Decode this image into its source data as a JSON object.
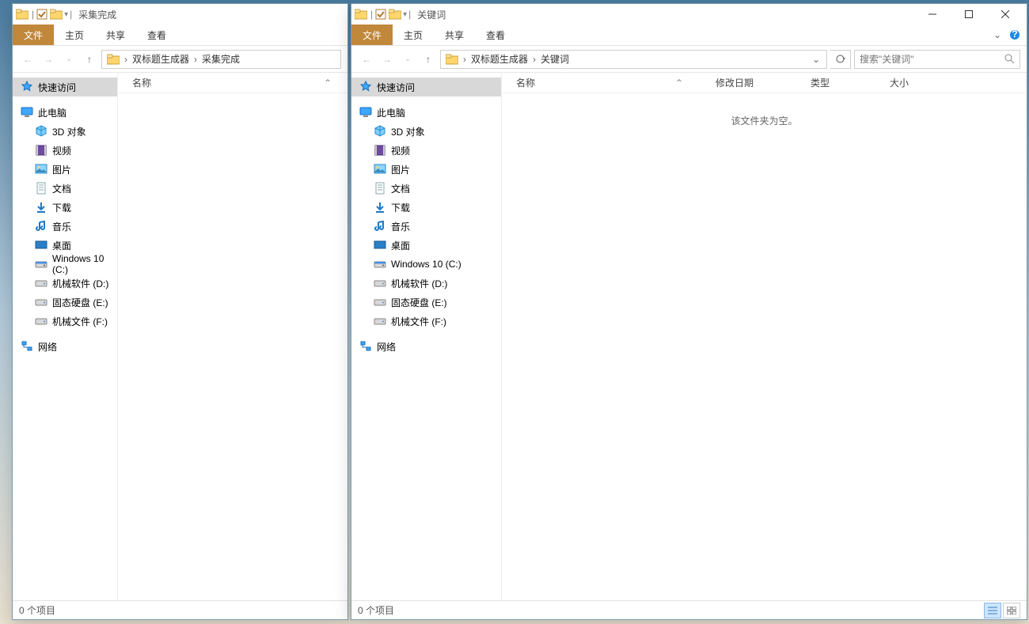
{
  "win1": {
    "title": "采集完成",
    "ribbon": {
      "file": "文件",
      "home": "主页",
      "share": "共享",
      "view": "查看"
    },
    "breadcrumb": [
      "双标题生成器",
      "采集完成"
    ],
    "columns": {
      "name": "名称"
    },
    "status": "0 个项目",
    "side": {
      "quick": "快速访问",
      "thispc": "此电脑",
      "items": [
        {
          "label": "3D 对象"
        },
        {
          "label": "视频"
        },
        {
          "label": "图片"
        },
        {
          "label": "文档"
        },
        {
          "label": "下载"
        },
        {
          "label": "音乐"
        },
        {
          "label": "桌面"
        },
        {
          "label": "Windows 10 (C:)"
        },
        {
          "label": "机械软件 (D:)"
        },
        {
          "label": "固态硬盘 (E:)"
        },
        {
          "label": "机械文件 (F:)"
        }
      ],
      "network": "网络"
    }
  },
  "win2": {
    "title": "关键词",
    "ribbon": {
      "file": "文件",
      "home": "主页",
      "share": "共享",
      "view": "查看"
    },
    "breadcrumb": [
      "双标题生成器",
      "关键词"
    ],
    "search_placeholder": "搜索\"关键词\"",
    "columns": {
      "name": "名称",
      "date": "修改日期",
      "type": "类型",
      "size": "大小"
    },
    "empty": "该文件夹为空。",
    "status": "0 个项目",
    "side": {
      "quick": "快速访问",
      "thispc": "此电脑",
      "items": [
        {
          "label": "3D 对象"
        },
        {
          "label": "视频"
        },
        {
          "label": "图片"
        },
        {
          "label": "文档"
        },
        {
          "label": "下载"
        },
        {
          "label": "音乐"
        },
        {
          "label": "桌面"
        },
        {
          "label": "Windows 10 (C:)"
        },
        {
          "label": "机械软件 (D:)"
        },
        {
          "label": "固态硬盘 (E:)"
        },
        {
          "label": "机械文件 (F:)"
        }
      ],
      "network": "网络"
    }
  }
}
